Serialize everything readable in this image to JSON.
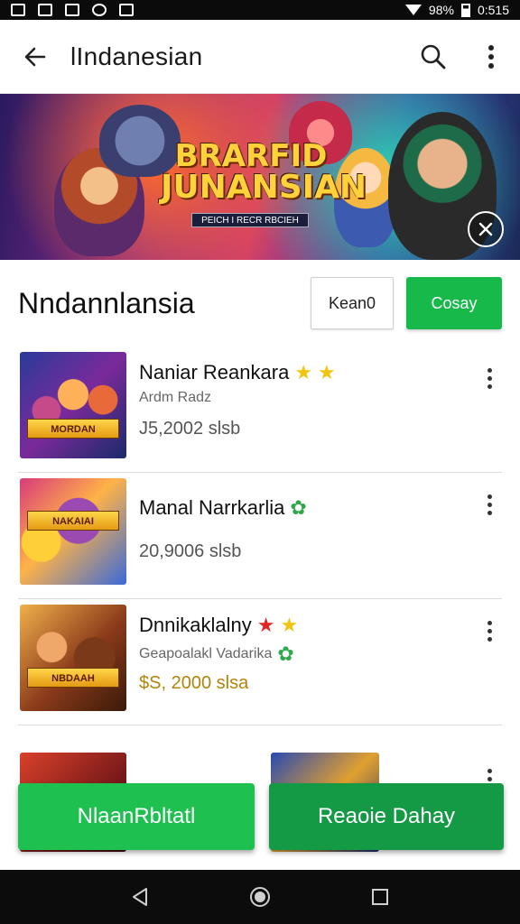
{
  "status_bar": {
    "battery": "98%",
    "time": "0:515"
  },
  "app_bar": {
    "title": "lIndanesian"
  },
  "banner": {
    "title_line1": "BRARFID",
    "title_line2": "JUNANSIAN",
    "subtitle": "PEICH I RECR RBCIEH"
  },
  "section": {
    "title": "Nndannlansia",
    "outline_button": "Kean0",
    "green_button": "Cosay"
  },
  "list": {
    "items": [
      {
        "name": "Naniar Reankara",
        "sub": "Ardm   Radz",
        "price": "J5,2002  slsb",
        "thumb_caption": "MORDAN"
      },
      {
        "name": "Manal Narrkarlia",
        "sub": "",
        "price": "20,9006  slsb",
        "thumb_caption": "NAKAIAI"
      },
      {
        "name": "Dnnikaklalny",
        "sub": "Geapoalakl Vadarika",
        "price": "$S, 2000  slsa",
        "thumb_caption": "NBDAAH"
      }
    ]
  },
  "bottom_buttons": {
    "left": "NlaanRbltatl",
    "right": "Reaoie Dahay"
  },
  "colors": {
    "green": "#17b94a",
    "dark_green": "#149a45",
    "star": "#f1c40f"
  }
}
